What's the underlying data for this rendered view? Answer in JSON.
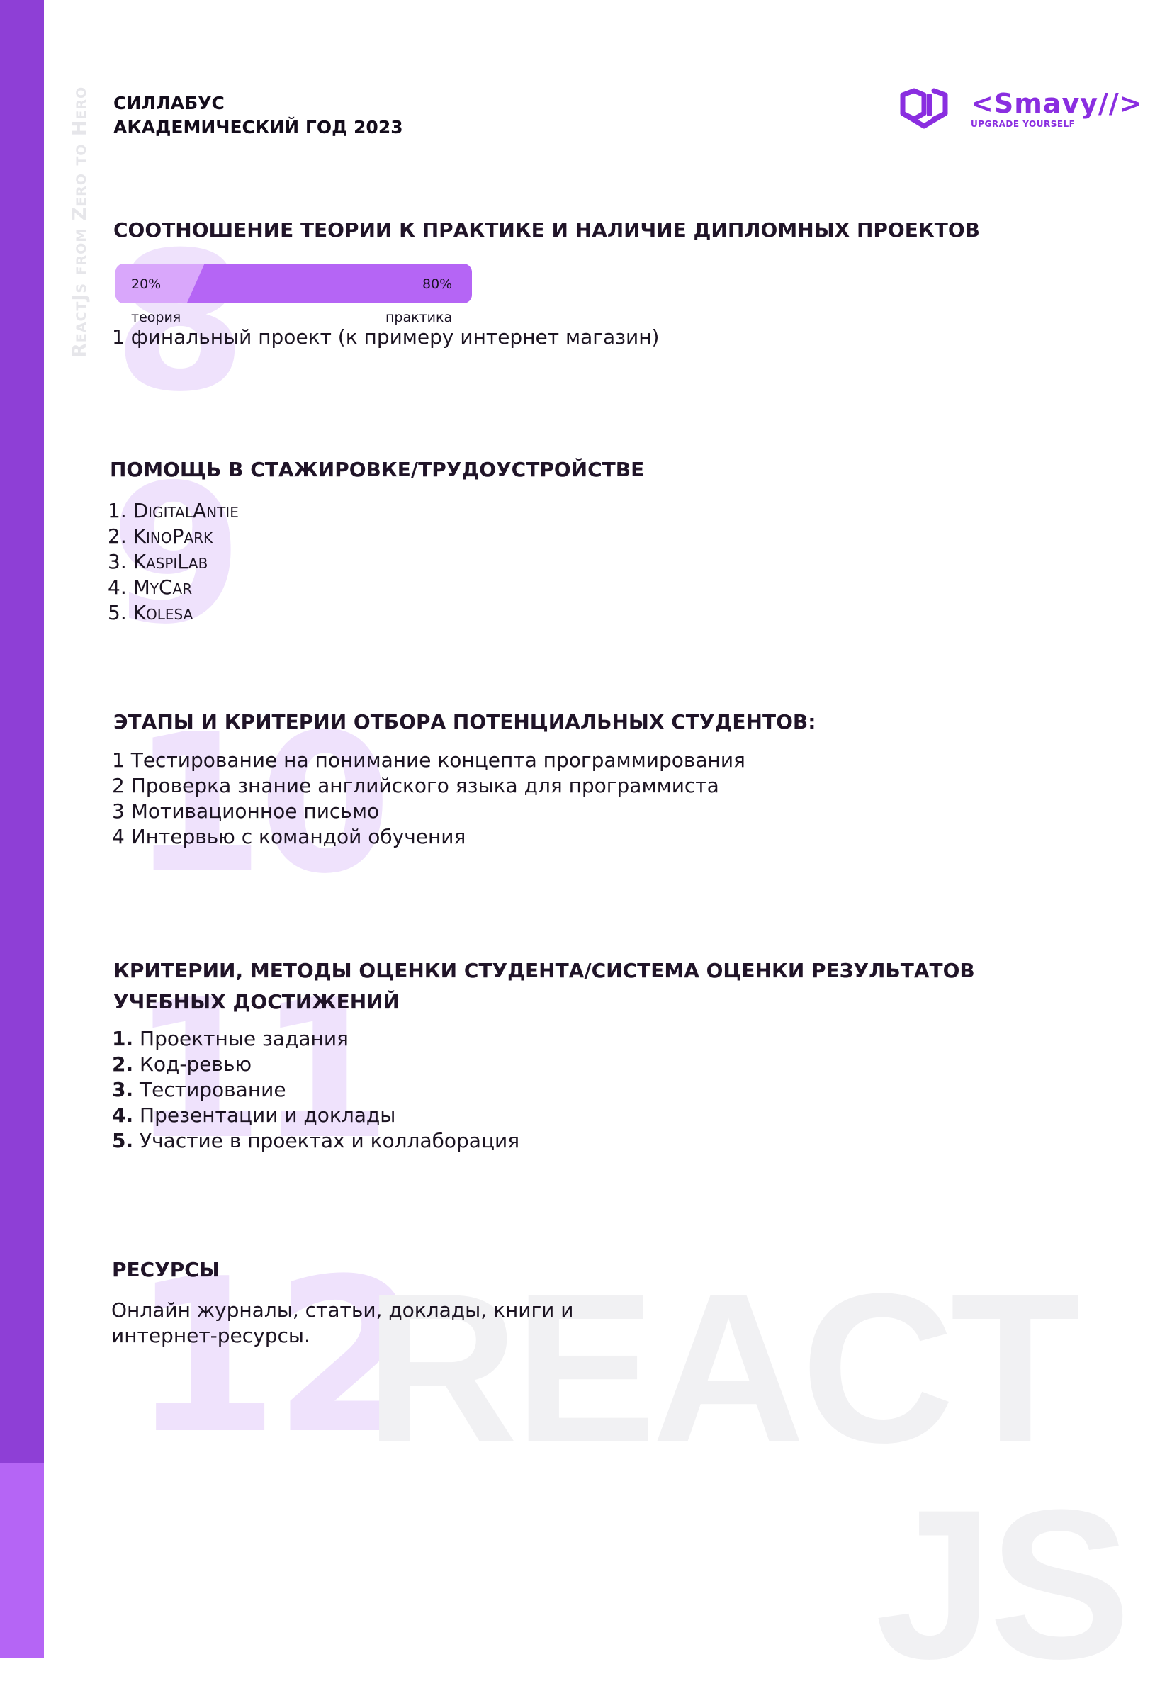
{
  "sidebar": {
    "vertical_text": "ReactJs from Zero to Hero"
  },
  "header": {
    "line1": "СИЛЛАБУС",
    "line2": "АКАДЕМИЧЕСКИЙ ГОД 2023"
  },
  "logo": {
    "name": "Smavy",
    "tagline": "UPGRADE YOURSELF",
    "icon": "box-code-icon"
  },
  "background_numbers": [
    "8",
    "9",
    "10",
    "11",
    "12"
  ],
  "watermark": {
    "react": "REACT",
    "js": "JS"
  },
  "sections": {
    "ratio": {
      "heading": "СООТНОШЕНИЕ ТЕОРИИ К ПРАКТИКЕ И НАЛИЧИЕ ДИПЛОМНЫХ ПРОЕКТОВ",
      "theory_percent": "20%",
      "practice_percent": "80%",
      "theory_label": "теория",
      "practice_label": "практика",
      "theory_fraction": 0.2,
      "practice_fraction": 0.8,
      "project_text": "1 финальный проект (к примеру интернет магазин)"
    },
    "internship": {
      "heading": "ПОМОЩЬ В СТАЖИРОВКЕ/ТРУДОУСТРОЙСТВЕ",
      "items": [
        "1. DigitalAntie",
        "2. KinoPark",
        "3. KaspiLab",
        "4. MyCar",
        "5. Kolesa"
      ]
    },
    "selection": {
      "heading": "ЭТАПЫ И КРИТЕРИИ ОТБОРА ПОТЕНЦИАЛЬНЫХ СТУДЕНТОВ:",
      "items": [
        "1 Тестирование на понимание концепта программирования",
        "2 Проверка знание английского языка для программиста",
        "3 Мотивационное письмо",
        "4 Интервью с командой обучения"
      ]
    },
    "assessment": {
      "heading_line1": "КРИТЕРИИ, МЕТОДЫ ОЦЕНКИ СТУДЕНТА/СИСТЕМА ОЦЕНКИ РЕЗУЛЬТАТОВ",
      "heading_line2": "УЧЕБНЫХ ДОСТИЖЕНИЙ",
      "items": [
        {
          "num": "1.",
          "text": "Проектные задания"
        },
        {
          "num": "2.",
          "text": "Код-ревью"
        },
        {
          "num": "3.",
          "text": "Тестирование"
        },
        {
          "num": "4.",
          "text": "Презентации и доклады"
        },
        {
          "num": "5.",
          "text": "Участие в проектах и коллаборация"
        }
      ]
    },
    "resources": {
      "heading": "РЕСУРСЫ",
      "line1": "Онлайн журналы, статьи, доклады, книги и",
      "line2": "интернет-ресурсы."
    }
  },
  "colors": {
    "sidebar": "#8e3fd6",
    "sidebar_bottom": "#b565f5",
    "progress_theory": "#d9a7fb",
    "progress_practice": "#b565f5",
    "accent_logo": "#8a2ee0"
  }
}
